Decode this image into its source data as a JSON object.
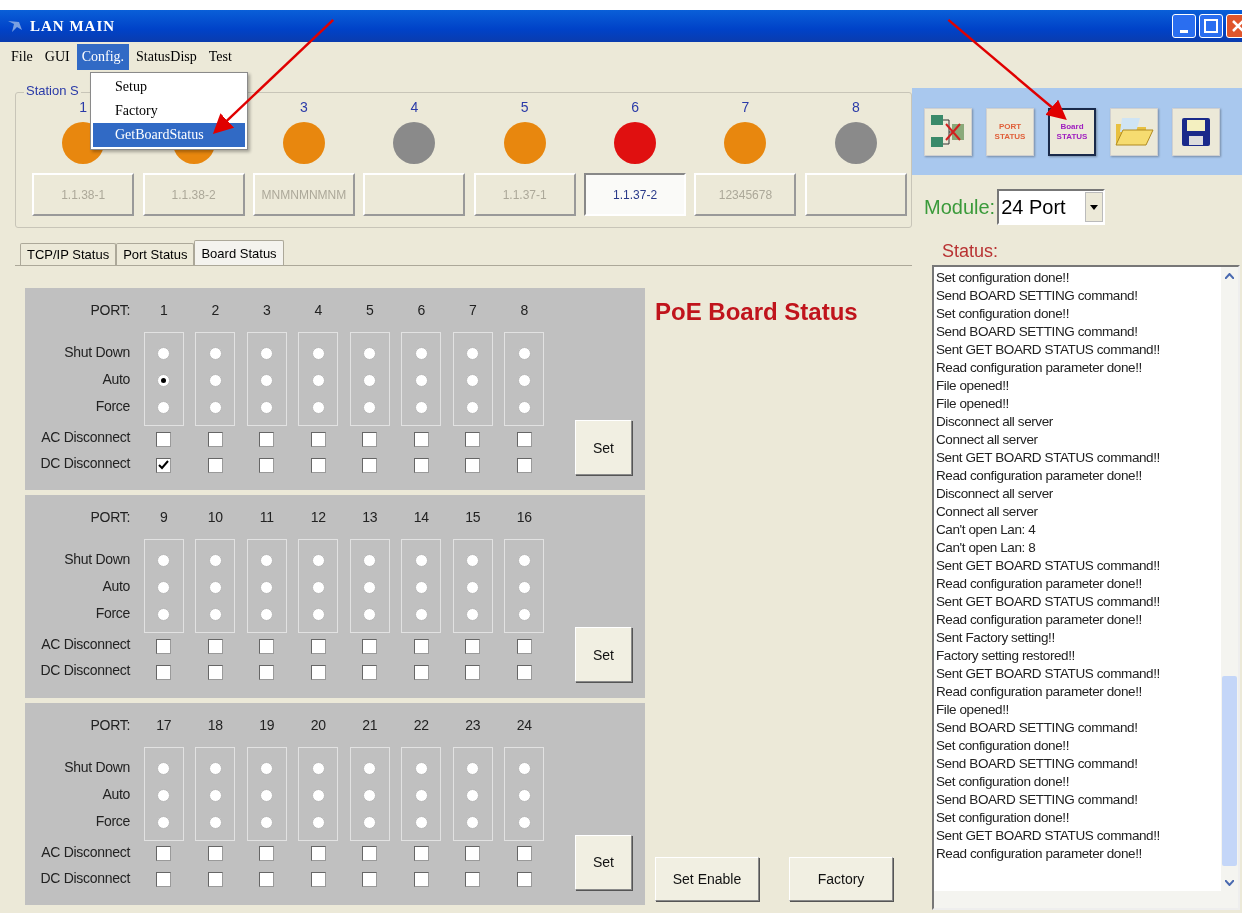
{
  "window": {
    "title": "LAN MAIN"
  },
  "menu_bar": [
    {
      "label": "File",
      "selected": false
    },
    {
      "label": "GUI",
      "selected": false
    },
    {
      "label": "Config.",
      "selected": true
    },
    {
      "label": "StatusDisp",
      "selected": false
    },
    {
      "label": "Test",
      "selected": false
    }
  ],
  "config_menu": [
    {
      "label": "Setup",
      "selected": false
    },
    {
      "label": "Factory",
      "selected": false
    },
    {
      "label": "GetBoardStatus",
      "selected": true
    }
  ],
  "station_group": {
    "legend": "Station S",
    "stations": [
      {
        "number": "1",
        "color": "#e8870e",
        "name": "1.1.38-1",
        "selected": false
      },
      {
        "color": "#e8870e",
        "name": "1.1.38-2",
        "selected": false
      },
      {
        "number": "3",
        "color": "#e8870e",
        "name": "MNMNMNMNM",
        "selected": false
      },
      {
        "number": "4",
        "color": "#8a8a8a",
        "selected": false
      },
      {
        "number": "5",
        "color": "#e8870e",
        "name": "1.1.37-1",
        "selected": false
      },
      {
        "number": "6",
        "color": "#e01010",
        "name": "1.1.37-2",
        "selected": true
      },
      {
        "number": "7",
        "color": "#e8870e",
        "name": "12345678",
        "selected": false
      },
      {
        "number": "8",
        "color": "#8a8a8a",
        "selected": false
      }
    ]
  },
  "toolbar": [
    {
      "kind": "disconnect",
      "selected": false
    },
    {
      "kind": "text",
      "label": "PORT STATUS",
      "selected": false
    },
    {
      "kind": "text",
      "label": "Board STATUS",
      "selected": true
    },
    {
      "kind": "open",
      "selected": false
    },
    {
      "kind": "save",
      "selected": false
    }
  ],
  "module": {
    "label": "Module:",
    "value": "24 Port"
  },
  "tabs": [
    {
      "label": "TCP/IP Status",
      "selected": false
    },
    {
      "label": "Port Status",
      "selected": false
    },
    {
      "label": "Board Status",
      "selected": true
    }
  ],
  "board": {
    "title": "PoE Board Status",
    "groups": [
      {
        "port_label": "PORT:",
        "mode_labels": [
          "Shut Down",
          "Auto",
          "Force"
        ],
        "ac_label": "AC Disconnect",
        "dc_label": "DC Disconnect",
        "button": "Set",
        "ports": [
          {
            "number": "1",
            "shut_down": false,
            "auto": true,
            "force": false,
            "ac_disconnect": false,
            "dc_disconnect": true
          },
          {
            "number": "2",
            "shut_down": false,
            "auto": false,
            "force": false,
            "ac_disconnect": false,
            "dc_disconnect": false
          },
          {
            "number": "3",
            "shut_down": false,
            "auto": false,
            "force": false,
            "ac_disconnect": false,
            "dc_disconnect": false
          },
          {
            "number": "4",
            "shut_down": false,
            "auto": false,
            "force": false,
            "ac_disconnect": false,
            "dc_disconnect": false
          },
          {
            "number": "5",
            "shut_down": false,
            "auto": false,
            "force": false,
            "ac_disconnect": false,
            "dc_disconnect": false
          },
          {
            "number": "6",
            "shut_down": false,
            "auto": false,
            "force": false,
            "ac_disconnect": false,
            "dc_disconnect": false
          },
          {
            "number": "7",
            "shut_down": false,
            "auto": false,
            "force": false,
            "ac_disconnect": false,
            "dc_disconnect": false
          },
          {
            "number": "8",
            "shut_down": false,
            "auto": false,
            "force": false,
            "ac_disconnect": false,
            "dc_disconnect": false
          }
        ]
      },
      {
        "port_label": "PORT:",
        "mode_labels": [
          "Shut Down",
          "Auto",
          "Force"
        ],
        "ac_label": "AC Disconnect",
        "dc_label": "DC Disconnect",
        "button": "Set",
        "ports": [
          {
            "number": "9",
            "shut_down": false,
            "auto": false,
            "force": false,
            "ac_disconnect": false,
            "dc_disconnect": false
          },
          {
            "number": "10",
            "shut_down": false,
            "auto": false,
            "force": false,
            "ac_disconnect": false,
            "dc_disconnect": false
          },
          {
            "number": "11",
            "shut_down": false,
            "auto": false,
            "force": false,
            "ac_disconnect": false,
            "dc_disconnect": false
          },
          {
            "number": "12",
            "shut_down": false,
            "auto": false,
            "force": false,
            "ac_disconnect": false,
            "dc_disconnect": false
          },
          {
            "number": "13",
            "shut_down": false,
            "auto": false,
            "force": false,
            "ac_disconnect": false,
            "dc_disconnect": false
          },
          {
            "number": "14",
            "shut_down": false,
            "auto": false,
            "force": false,
            "ac_disconnect": false,
            "dc_disconnect": false
          },
          {
            "number": "15",
            "shut_down": false,
            "auto": false,
            "force": false,
            "ac_disconnect": false,
            "dc_disconnect": false
          },
          {
            "number": "16",
            "shut_down": false,
            "auto": false,
            "force": false,
            "ac_disconnect": false,
            "dc_disconnect": false
          }
        ]
      },
      {
        "port_label": "PORT:",
        "mode_labels": [
          "Shut Down",
          "Auto",
          "Force"
        ],
        "ac_label": "AC Disconnect",
        "dc_label": "DC Disconnect",
        "button": "Set",
        "ports": [
          {
            "number": "17",
            "shut_down": false,
            "auto": false,
            "force": false,
            "ac_disconnect": false,
            "dc_disconnect": false
          },
          {
            "number": "18",
            "shut_down": false,
            "auto": false,
            "force": false,
            "ac_disconnect": false,
            "dc_disconnect": false
          },
          {
            "number": "19",
            "shut_down": false,
            "auto": false,
            "force": false,
            "ac_disconnect": false,
            "dc_disconnect": false
          },
          {
            "number": "20",
            "shut_down": false,
            "auto": false,
            "force": false,
            "ac_disconnect": false,
            "dc_disconnect": false
          },
          {
            "number": "21",
            "shut_down": false,
            "auto": false,
            "force": false,
            "ac_disconnect": false,
            "dc_disconnect": false
          },
          {
            "number": "22",
            "shut_down": false,
            "auto": false,
            "force": false,
            "ac_disconnect": false,
            "dc_disconnect": false
          },
          {
            "number": "23",
            "shut_down": false,
            "auto": false,
            "force": false,
            "ac_disconnect": false,
            "dc_disconnect": false
          },
          {
            "number": "24",
            "shut_down": false,
            "auto": false,
            "force": false,
            "ac_disconnect": false,
            "dc_disconnect": false
          }
        ]
      }
    ],
    "buttons": [
      "Set Enable",
      "Factory"
    ]
  },
  "status": {
    "title": "Status:",
    "log": [
      "Set configuration done!!",
      "Send BOARD SETTING command!",
      "Set configuration done!!",
      "Send BOARD SETTING command!",
      "Sent GET BOARD STATUS command!!",
      "Read configuration parameter done!!",
      "File opened!!",
      "File opened!!",
      "Disconnect all server",
      "Connect all server",
      "Sent GET BOARD STATUS command!!",
      "Read configuration parameter done!!",
      "Disconnect all server",
      "Connect all server",
      "Can't open Lan: 4",
      "Can't open Lan: 8",
      "Sent GET BOARD STATUS command!!",
      "Read configuration parameter done!!",
      "Sent GET BOARD STATUS command!!",
      "Read configuration parameter done!!",
      "Sent Factory setting!!",
      "Factory setting restored!!",
      "Sent GET BOARD STATUS command!!",
      "Read configuration parameter done!!",
      "File opened!!",
      "Send BOARD SETTING command!",
      "Set configuration done!!",
      "Send BOARD SETTING command!",
      "Set configuration done!!",
      "Send BOARD SETTING command!",
      "Set configuration done!!",
      "Sent GET BOARD STATUS command!!",
      "Read configuration parameter done!!"
    ]
  }
}
